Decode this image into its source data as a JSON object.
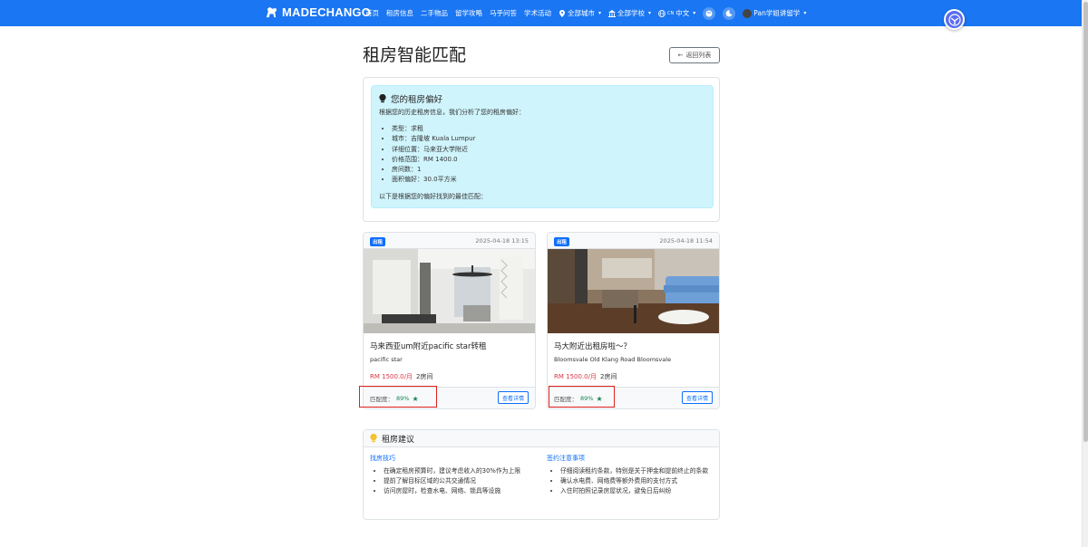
{
  "nav": {
    "brand": "MADECHANGO",
    "links": [
      "首页",
      "租房信息",
      "二手物品",
      "留学攻略",
      "马乎问答",
      "学术活动"
    ],
    "city": "全部城市",
    "school": "全部学校",
    "lang_code": "CN",
    "lang": "中文",
    "user": "Pan学姐讲留学"
  },
  "page": {
    "title": "租房智能匹配",
    "back_label": "返回列表"
  },
  "preferences": {
    "heading": "您的租房偏好",
    "intro": "根据您的历史租房信息，我们分析了您的租房偏好：",
    "items": [
      "类型：求租",
      "城市：吉隆坡 Kuala Lumpur",
      "详细位置：马来亚大学附近",
      "价格范围：RM 1400.0",
      "房间数：1",
      "面积偏好：30.0平方米"
    ],
    "outro": "以下是根据您的偏好找到的最佳匹配："
  },
  "listings": [
    {
      "type": "出租",
      "date": "2025-04-18 13:15",
      "title": "马来西亚um附近pacific star转租",
      "address": "pacific star",
      "price": "RM 1500.0/月",
      "rooms": "2房间",
      "match_label": "匹配度：",
      "match_pct": "89%",
      "detail_label": "查看详情"
    },
    {
      "type": "出租",
      "date": "2025-04-18 11:54",
      "title": "马大附近出租房啦～？",
      "address": "Bloomsvale Old Klang Road Bloomsvale",
      "price": "RM 1500.0/月",
      "rooms": "2房间",
      "match_label": "匹配度：",
      "match_pct": "89%",
      "detail_label": "查看详情"
    }
  ],
  "advice": {
    "heading": "租房建议",
    "tips_title": "找房技巧",
    "tips": [
      "在确定租房预算时，建议考虑收入的30%作为上限",
      "提前了解目标区域的公共交通情况",
      "访问房屋时，检查水电、网络、锁具等设施"
    ],
    "contract_title": "签约注意事项",
    "contract": [
      "仔细阅读租约条款，特别是关于押金和提前终止的条款",
      "确认水电费、网络费等额外费用的支付方式",
      "入住时拍照记录房屋状况，避免日后纠纷"
    ]
  },
  "colors": {
    "nav": "#1a76f2",
    "info_bg": "#cff4fc",
    "price": "#dc3545",
    "match": "#198754",
    "highlight": "#e02020"
  }
}
